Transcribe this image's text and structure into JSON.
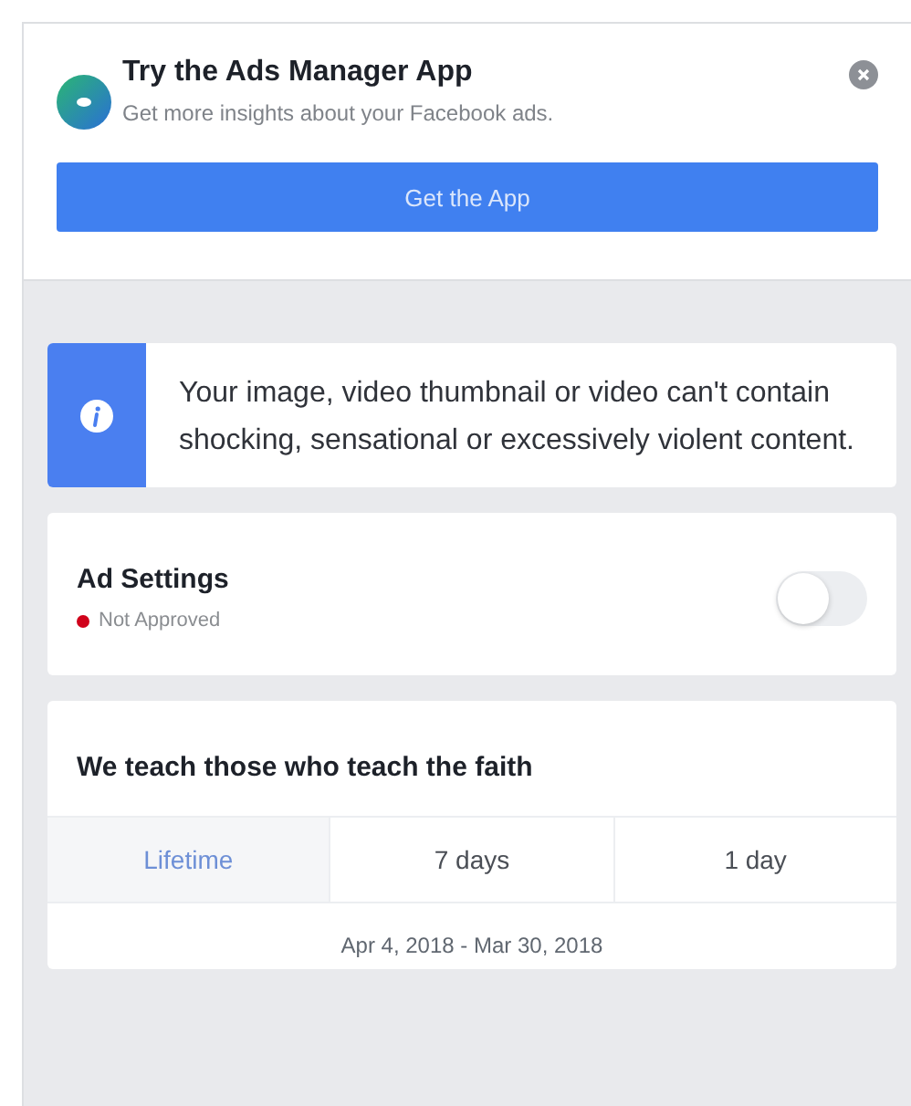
{
  "promo": {
    "title": "Try the Ads Manager App",
    "subtitle": "Get more insights about your Facebook ads.",
    "button": "Get the App"
  },
  "notice": {
    "text": "Your image, video thumbnail or video can't contain shocking, sensational or excessively violent content."
  },
  "ad_settings": {
    "title": "Ad Settings",
    "status": "Not Approved",
    "on": false
  },
  "campaign": {
    "title": "We teach those who teach the faith",
    "tabs": [
      {
        "label": "Lifetime",
        "selected": true
      },
      {
        "label": "7 days",
        "selected": false
      },
      {
        "label": "1 day",
        "selected": false
      }
    ],
    "date_range": "Apr 4, 2018 - Mar 30, 2018"
  }
}
